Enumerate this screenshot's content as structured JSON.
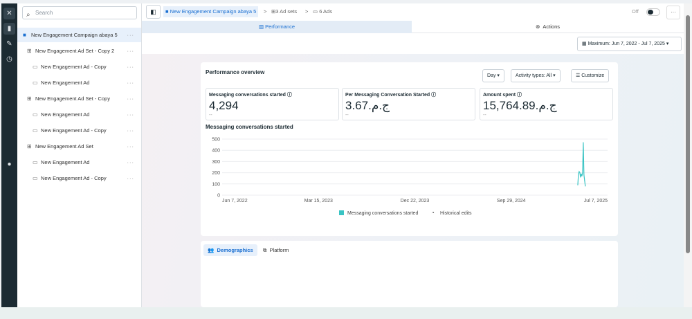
{
  "rail": {
    "icons": [
      "close-icon",
      "chart-icon",
      "pencil-icon",
      "clock-icon",
      "info-icon"
    ]
  },
  "sidebar": {
    "search_placeholder": "Search",
    "items": [
      {
        "type": "campaign",
        "label": "New Engagement Campaign abaya 5"
      },
      {
        "type": "adset",
        "label": "New Engagement Ad Set - Copy 2"
      },
      {
        "type": "ad",
        "label": "New Engagement Ad - Copy"
      },
      {
        "type": "ad",
        "label": "New Engagement Ad"
      },
      {
        "type": "adset",
        "label": "New Engagement Ad Set - Copy"
      },
      {
        "type": "ad",
        "label": "New Engagement Ad"
      },
      {
        "type": "ad",
        "label": "New Engagement Ad - Copy"
      },
      {
        "type": "adset",
        "label": "New Engagement Ad Set"
      },
      {
        "type": "ad",
        "label": "New Engagement Ad"
      },
      {
        "type": "ad",
        "label": "New Engagement Ad - Copy"
      }
    ],
    "more": "···"
  },
  "header": {
    "campaign": "New Engagement Campaign abaya 5",
    "adsets": "3 Ad sets",
    "ads": "6 Ads",
    "sep": ">",
    "status": "Off",
    "more": "···"
  },
  "tabs": {
    "performance": "Performance",
    "actions": "Actions"
  },
  "date_range": "Maximum: Jun 7, 2022 - Jul 7, 2025",
  "overview": {
    "title": "Performance overview",
    "day": "Day",
    "activity": "Activity types: All",
    "customize": "Customize",
    "metrics": [
      {
        "title": "Messaging conversations started",
        "value": "4,294",
        "delta": "--"
      },
      {
        "title": "Per Messaging Conversation Started",
        "value": "3.67.ج.م",
        "delta": "--"
      },
      {
        "title": "Amount spent",
        "value": "15,764.89.ج.م",
        "delta": "--"
      }
    ]
  },
  "chart_data": {
    "type": "line",
    "title": "Messaging conversations started",
    "ylim": [
      0,
      500
    ],
    "yticks": [
      "0",
      "100",
      "200",
      "300",
      "400",
      "500"
    ],
    "xticks": [
      "Jun 7, 2022",
      "Mar 15, 2023",
      "Dec 22, 2023",
      "Sep 29, 2024",
      "Jul 7, 2025"
    ],
    "x_range_days": 1126,
    "series": [
      {
        "name": "Messaging conversations started",
        "color": "#3ac4c4",
        "x_days": [
          1039,
          1041,
          1043,
          1045,
          1047,
          1049,
          1051,
          1053,
          1055,
          1057,
          1059,
          1061
        ],
        "values": [
          90,
          190,
          210,
          200,
          160,
          190,
          170,
          200,
          470,
          180,
          130,
          80
        ]
      }
    ],
    "legend": [
      "Messaging conversations started",
      "Historical edits"
    ]
  },
  "breakdown": {
    "tabs": [
      "Demographics",
      "Platform"
    ]
  }
}
